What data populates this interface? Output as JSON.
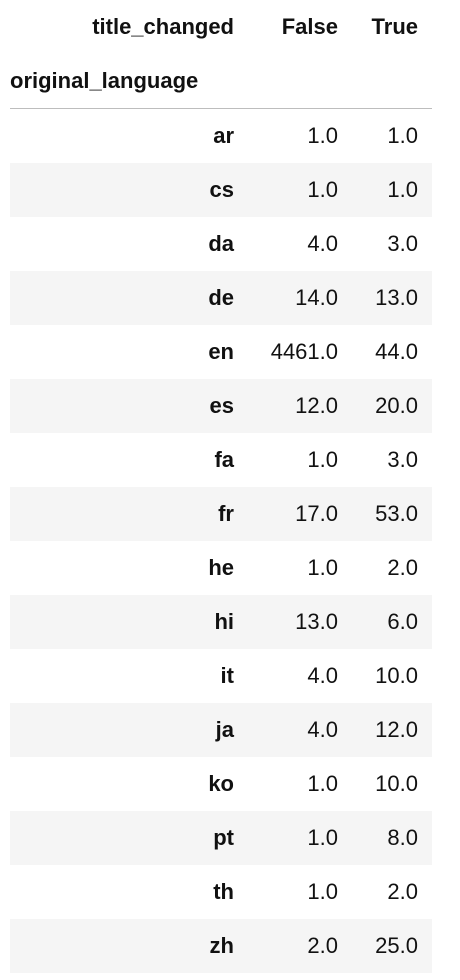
{
  "table": {
    "columns_name": "title_changed",
    "index_name": "original_language",
    "columns": [
      "False",
      "True"
    ],
    "rows": [
      {
        "index": "ar",
        "values": [
          "1.0",
          "1.0"
        ]
      },
      {
        "index": "cs",
        "values": [
          "1.0",
          "1.0"
        ]
      },
      {
        "index": "da",
        "values": [
          "4.0",
          "3.0"
        ]
      },
      {
        "index": "de",
        "values": [
          "14.0",
          "13.0"
        ]
      },
      {
        "index": "en",
        "values": [
          "4461.0",
          "44.0"
        ]
      },
      {
        "index": "es",
        "values": [
          "12.0",
          "20.0"
        ]
      },
      {
        "index": "fa",
        "values": [
          "1.0",
          "3.0"
        ]
      },
      {
        "index": "fr",
        "values": [
          "17.0",
          "53.0"
        ]
      },
      {
        "index": "he",
        "values": [
          "1.0",
          "2.0"
        ]
      },
      {
        "index": "hi",
        "values": [
          "13.0",
          "6.0"
        ]
      },
      {
        "index": "it",
        "values": [
          "4.0",
          "10.0"
        ]
      },
      {
        "index": "ja",
        "values": [
          "4.0",
          "12.0"
        ]
      },
      {
        "index": "ko",
        "values": [
          "1.0",
          "10.0"
        ]
      },
      {
        "index": "pt",
        "values": [
          "1.0",
          "8.0"
        ]
      },
      {
        "index": "th",
        "values": [
          "1.0",
          "2.0"
        ]
      },
      {
        "index": "zh",
        "values": [
          "2.0",
          "25.0"
        ]
      }
    ]
  }
}
